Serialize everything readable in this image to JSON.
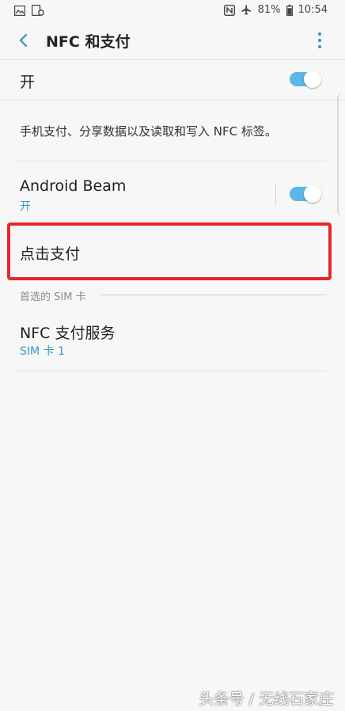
{
  "status_bar": {
    "battery": "81%",
    "time": "10:54",
    "icons": [
      "gallery-notification-icon",
      "sim-notification-icon",
      "nfc-icon",
      "airplane-mode-icon",
      "battery-icon"
    ]
  },
  "app_bar": {
    "title": "NFC 和支付",
    "back_icon": "back-arrow-icon",
    "more_icon": "more-vert-icon"
  },
  "master_switch": {
    "label": "开",
    "on": true
  },
  "description": "手机支付、分享数据以及读取和写入 NFC 标签。",
  "android_beam": {
    "title": "Android Beam",
    "subtitle": "开",
    "on": true
  },
  "tap_and_pay": {
    "title": "点击支付"
  },
  "section": {
    "header": "首选的 SIM 卡"
  },
  "nfc_payment_service": {
    "title": "NFC 支付服务",
    "subtitle": "SIM 卡 1"
  },
  "watermark": "头条号 / 无线石家庄",
  "colors": {
    "accent": "#3a9bc9",
    "toggle_on": "#5ab8e8",
    "highlight": "#e5282a",
    "background": "#f7f7f7"
  }
}
